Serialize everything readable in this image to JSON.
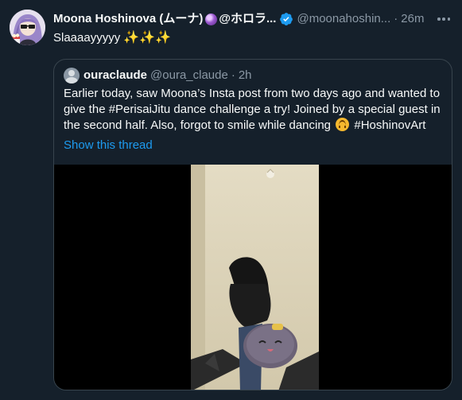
{
  "tweet": {
    "display_name": "Moona Hoshinova (ムーナ)",
    "display_name_suffix": "@ホロラ...",
    "handle": "@moonahoshin...",
    "separator": "·",
    "time": "26m",
    "text": "Slaaaayyyyy",
    "sparkles": "✨✨✨",
    "verified": true,
    "icons": [
      "avatar",
      "purple-orb-emoji-icon",
      "verified-badge-icon",
      "more-options-icon"
    ]
  },
  "quote": {
    "display_name": "ouraclaude",
    "handle": "@oura_claude",
    "separator": "·",
    "time": "2h",
    "text_before_emoji": "Earlier today, saw Moona’s Insta post from two days ago and wanted to give the #PerisaiJitu dance challenge a try! Joined by a special guest in the second half. Also, forgot to smile while dancing ",
    "text_after_emoji": " #HoshinovArt",
    "show_thread": "Show this thread",
    "icons": [
      "default-avatar-icon",
      "upside-down-face-emoji-icon",
      "video-thumbnail"
    ]
  },
  "colors": {
    "background": "#15202b",
    "border": "#38444d",
    "text_primary": "#f7f9f9",
    "text_secondary": "#8b98a5",
    "accent": "#1d9bf0"
  }
}
